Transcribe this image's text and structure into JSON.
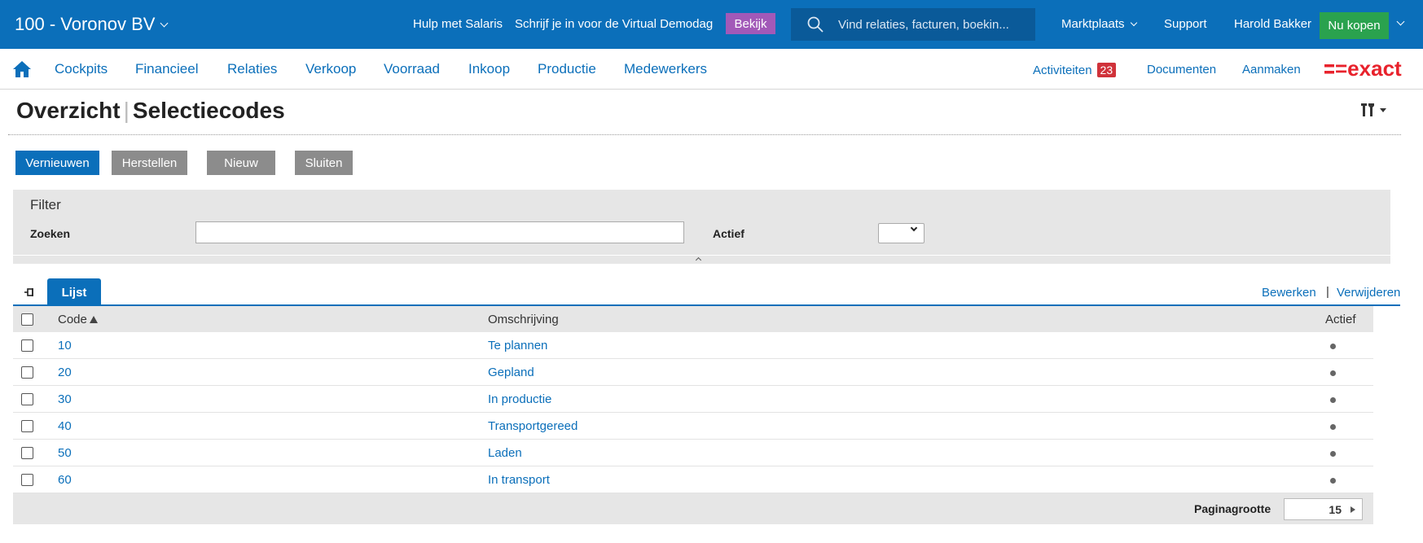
{
  "topbar": {
    "company": "100 - Voronov BV",
    "help_link": "Hulp met Salaris",
    "promo_text": "Schrijf je in voor de Virtual Demodag",
    "promo_button": "Bekijk",
    "search_placeholder": "Vind relaties, facturen, boekin...",
    "marketplace": "Marktplaats",
    "support": "Support",
    "user": "Harold Bakker",
    "buy_button": "Nu kopen"
  },
  "nav": {
    "items": [
      "Cockpits",
      "Financieel",
      "Relaties",
      "Verkoop",
      "Voorraad",
      "Inkoop",
      "Productie",
      "Medewerkers"
    ],
    "activities": "Activiteiten",
    "activities_count": "23",
    "documents": "Documenten",
    "create": "Aanmaken",
    "logo": "=exact"
  },
  "page": {
    "title_main": "Overzicht",
    "title_sep": "|",
    "title_sub": "Selectiecodes"
  },
  "toolbar": {
    "refresh": "Vernieuwen",
    "reset": "Herstellen",
    "new": "Nieuw",
    "close": "Sluiten"
  },
  "filter": {
    "title": "Filter",
    "search_label": "Zoeken",
    "search_value": "",
    "active_label": "Actief",
    "active_value": ""
  },
  "tabs": {
    "list": "Lijst",
    "edit": "Bewerken",
    "sep": "|",
    "delete": "Verwijderen"
  },
  "table": {
    "columns": {
      "code": "Code",
      "description": "Omschrijving",
      "active": "Actief"
    },
    "rows": [
      {
        "code": "10",
        "description": "Te plannen",
        "active": true
      },
      {
        "code": "20",
        "description": "Gepland",
        "active": true
      },
      {
        "code": "30",
        "description": "In productie",
        "active": true
      },
      {
        "code": "40",
        "description": "Transportgereed",
        "active": true
      },
      {
        "code": "50",
        "description": "Laden",
        "active": true
      },
      {
        "code": "60",
        "description": "In transport",
        "active": true
      }
    ],
    "page_size_label": "Paginagrootte",
    "page_size": "15"
  },
  "colors": {
    "brand_blue": "#0b6fba",
    "promo_purple": "#a259b8",
    "buy_green": "#2aa24e",
    "badge_red": "#d0323a",
    "logo_red": "#e8222c"
  }
}
